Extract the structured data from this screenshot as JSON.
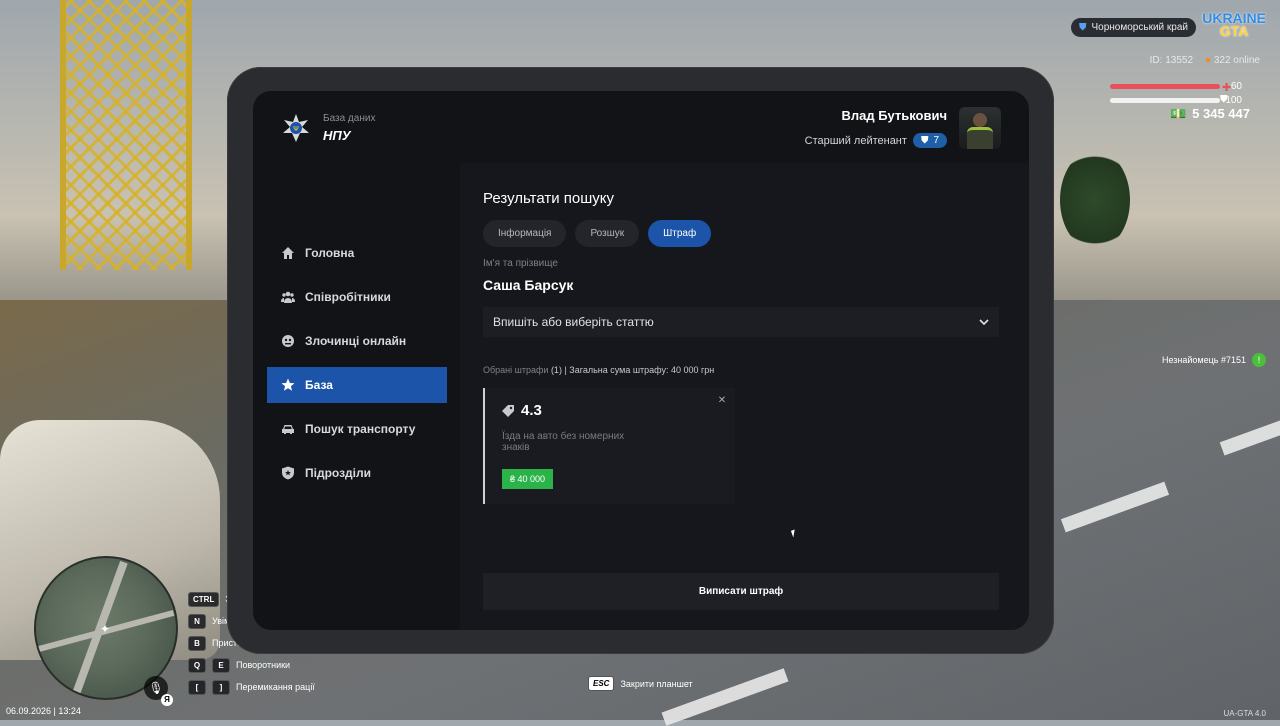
{
  "hud": {
    "region": "Чорноморський край",
    "logo_top": "UKRAINE",
    "logo_bottom": "GTA",
    "player_id": "ID: 13552",
    "online": "322 online",
    "health": "60",
    "armor": "100",
    "money": "5 345 447",
    "stranger": "Незнайомець #7151",
    "datetime": "06.09.2026 | 13:24",
    "mic_key": "Я",
    "version": "UA-GTA 4.0",
    "colors": {
      "health": "#e8505b",
      "armor": "#f2f2f2",
      "stranger": "#4bbf3c"
    }
  },
  "hints": [
    {
      "key": "CTRL",
      "label": "З"
    },
    {
      "key": "N",
      "label": "Увім"
    },
    {
      "key": "B",
      "label": "Присте"
    },
    {
      "key": "Q",
      "key2": "E",
      "label": "Поворотники"
    },
    {
      "key": "[",
      "key2": "]",
      "label": "Перемикання рації"
    }
  ],
  "esc_hint": {
    "key": "ESC",
    "label": "Закрити планшет"
  },
  "tablet": {
    "brand": {
      "subtitle": "База даних",
      "title": "НПУ"
    },
    "user": {
      "name": "Влад Бутькович",
      "rank": "Старший лейтенант",
      "level": "7"
    },
    "nav": [
      {
        "label": "Головна",
        "icon": "home-icon",
        "active": false
      },
      {
        "label": "Співробітники",
        "icon": "people-icon",
        "active": false
      },
      {
        "label": "Злочинці онлайн",
        "icon": "mask-icon",
        "active": false
      },
      {
        "label": "База",
        "icon": "star-icon",
        "active": true
      },
      {
        "label": "Пошук транспорту",
        "icon": "car-icon",
        "active": false
      },
      {
        "label": "Підрозділи",
        "icon": "shield-icon",
        "active": false
      }
    ],
    "content": {
      "title": "Результати пошуку",
      "tabs": [
        {
          "label": "Інформація",
          "active": false
        },
        {
          "label": "Розшук",
          "active": false
        },
        {
          "label": "Штраф",
          "active": true
        }
      ],
      "name_label": "Ім'я та прізвище",
      "name_value": "Саша Барсук",
      "select_placeholder": "Впишіть або виберіть статтю",
      "summary_prefix": "Обрані штрафи",
      "summary_count": "(1)",
      "summary_rest": "| Загальна сума штрафу: 40 000 грн",
      "fine": {
        "article": "4.3",
        "description": "Їзда на авто без номерних знаків",
        "amount": "₴ 40 000"
      },
      "submit_label": "Виписати штраф"
    },
    "colors": {
      "accent": "#1b54a8",
      "fine_amount": "#2bb34a",
      "rank_badge": "#1e5fa8"
    }
  }
}
